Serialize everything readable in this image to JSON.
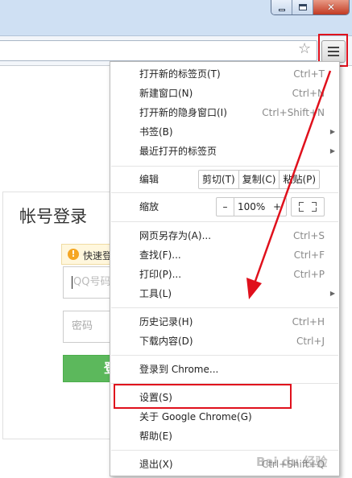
{
  "window": {
    "minimize_icon": "minimize-icon",
    "maximize_icon": "maximize-icon",
    "close_icon": "close-icon",
    "close_glyph": "✕"
  },
  "toolbar": {
    "star_glyph": "☆",
    "menu_icon": "hamburger-menu-icon"
  },
  "login": {
    "title": "帐号登录",
    "quick_login": "快速登",
    "warn_glyph": "!",
    "qq_placeholder": "QQ号码",
    "password_placeholder": "密码",
    "login_button": "登"
  },
  "menu": {
    "items_group1": [
      {
        "label": "打开新的标签页(T)",
        "shortcut": "Ctrl+T"
      },
      {
        "label": "新建窗口(N)",
        "shortcut": "Ctrl+N"
      },
      {
        "label": "打开新的隐身窗口(I)",
        "shortcut": "Ctrl+Shift+N"
      },
      {
        "label": "书签(B)",
        "shortcut": ""
      },
      {
        "label": "最近打开的标签页",
        "shortcut": ""
      }
    ],
    "edit": {
      "label": "编辑",
      "cut": "剪切(T)",
      "copy": "复制(C)",
      "paste": "粘贴(P)"
    },
    "zoom": {
      "label": "缩放",
      "minus": "–",
      "value": "100%",
      "plus": "+"
    },
    "items_group2": [
      {
        "label": "网页另存为(A)...",
        "shortcut": "Ctrl+S"
      },
      {
        "label": "查找(F)...",
        "shortcut": "Ctrl+F"
      },
      {
        "label": "打印(P)...",
        "shortcut": "Ctrl+P"
      },
      {
        "label": "工具(L)",
        "shortcut": ""
      }
    ],
    "items_group3": [
      {
        "label": "历史记录(H)",
        "shortcut": "Ctrl+H"
      },
      {
        "label": "下载内容(D)",
        "shortcut": "Ctrl+J"
      }
    ],
    "signin": "登录到 Chrome...",
    "settings": "设置(S)",
    "about": "关于 Google Chrome(G)",
    "help": "帮助(E)",
    "exit": {
      "label": "退出(X)",
      "shortcut": "Ctrl+Shift+Q"
    },
    "submenu_arrow": "▶"
  },
  "annotations": {
    "highlight_color": "#e0101c",
    "arrow_color": "#e0101c"
  },
  "watermark": "Bai du 经验"
}
